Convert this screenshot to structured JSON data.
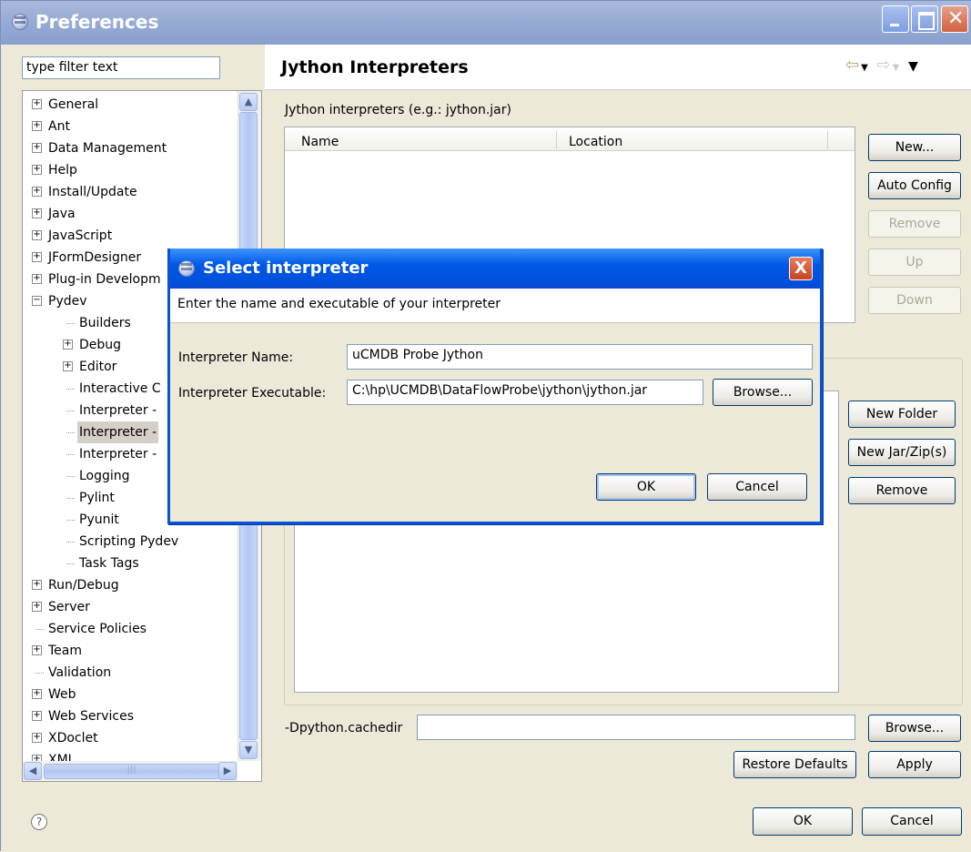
{
  "window": {
    "title": "Preferences"
  },
  "filter": {
    "value": "type filter text"
  },
  "tree": {
    "items": [
      {
        "label": "General",
        "expander": "+"
      },
      {
        "label": "Ant",
        "expander": "+"
      },
      {
        "label": "Data Management",
        "expander": "+"
      },
      {
        "label": "Help",
        "expander": "+"
      },
      {
        "label": "Install/Update",
        "expander": "+"
      },
      {
        "label": "Java",
        "expander": "+"
      },
      {
        "label": "JavaScript",
        "expander": "+"
      },
      {
        "label": "JFormDesigner",
        "expander": "+"
      },
      {
        "label": "Plug-in Developm",
        "expander": "+"
      },
      {
        "label": "Pydev",
        "expander": "−"
      },
      {
        "label": "Builders",
        "expander": ""
      },
      {
        "label": "Debug",
        "expander": "+"
      },
      {
        "label": "Editor",
        "expander": "+"
      },
      {
        "label": "Interactive C",
        "expander": ""
      },
      {
        "label": "Interpreter -",
        "expander": ""
      },
      {
        "label": "Interpreter -",
        "expander": ""
      },
      {
        "label": "Interpreter -",
        "expander": ""
      },
      {
        "label": "Logging",
        "expander": ""
      },
      {
        "label": "Pylint",
        "expander": ""
      },
      {
        "label": "Pyunit",
        "expander": ""
      },
      {
        "label": "Scripting Pydev",
        "expander": ""
      },
      {
        "label": "Task Tags",
        "expander": ""
      },
      {
        "label": "Run/Debug",
        "expander": "+"
      },
      {
        "label": "Server",
        "expander": "+"
      },
      {
        "label": "Service Policies",
        "expander": ""
      },
      {
        "label": "Team",
        "expander": "+"
      },
      {
        "label": "Validation",
        "expander": ""
      },
      {
        "label": "Web",
        "expander": "+"
      },
      {
        "label": "Web Services",
        "expander": "+"
      },
      {
        "label": "XDoclet",
        "expander": "+"
      },
      {
        "label": "XML",
        "expander": "+"
      }
    ],
    "selected_index": 15
  },
  "panel": {
    "title": "Jython Interpreters",
    "interpreters_label": "Jython interpreters (e.g.: jython.jar)",
    "columns": [
      "Name",
      "Location"
    ],
    "buttons": {
      "new": "New...",
      "auto_config": "Auto Config",
      "remove": "Remove",
      "up": "Up",
      "down": "Down",
      "new_folder": "New Folder",
      "new_jar": "New Jar/Zip(s)",
      "remove_lib": "Remove"
    },
    "cachedir_label": "-Dpython.cachedir",
    "cachedir_value": "",
    "browse": "Browse...",
    "restore_defaults": "Restore Defaults",
    "apply": "Apply"
  },
  "footer": {
    "ok": "OK",
    "cancel": "Cancel",
    "help_glyph": "?"
  },
  "dialog": {
    "title": "Select interpreter",
    "message": "Enter the name and executable of your interpreter",
    "name_label": "Interpreter Name:",
    "name_value": "uCMDB Probe Jython",
    "exe_label": "Interpreter Executable:",
    "exe_value": "C:\\hp\\UCMDB\\DataFlowProbe\\jython\\jython.jar",
    "browse": "Browse...",
    "ok": "OK",
    "cancel": "Cancel",
    "close_glyph": "X"
  },
  "icons": {
    "title_icon": "eclipse-icon",
    "nav": "back-forward-menu-icons"
  },
  "colors": {
    "xp_title": "#0058e6",
    "inactive_title": "#94a9d4",
    "face": "#ece9d8"
  }
}
